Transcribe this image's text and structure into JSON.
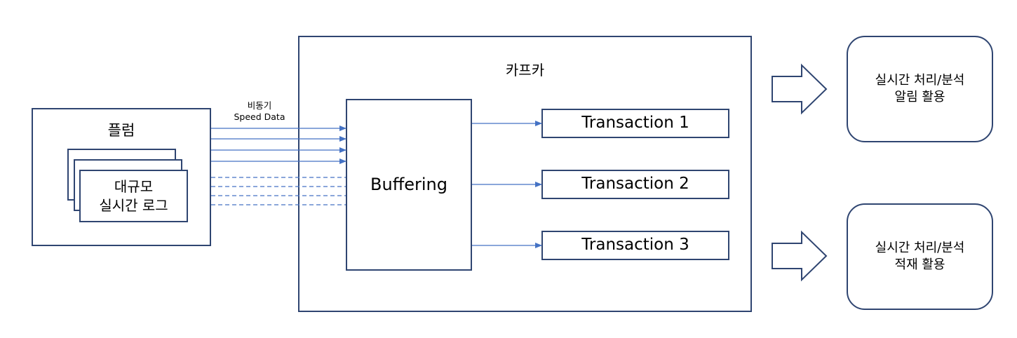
{
  "flume": {
    "title": "플럼",
    "log_line1": "대규모",
    "log_line2": "실시간 로그"
  },
  "connection": {
    "label_line1": "비동기",
    "label_line2": "Speed Data"
  },
  "kafka": {
    "title": "카프카",
    "buffer": "Buffering",
    "transactions": [
      "Transaction 1",
      "Transaction 2",
      "Transaction 3"
    ]
  },
  "outputs": [
    {
      "line1": "실시간 처리/분석",
      "line2": "알림 활용"
    },
    {
      "line1": "실시간 처리/분석",
      "line2": "적재 활용"
    }
  ],
  "colors": {
    "border": "#2f4571",
    "arrow": "#4472c4"
  }
}
